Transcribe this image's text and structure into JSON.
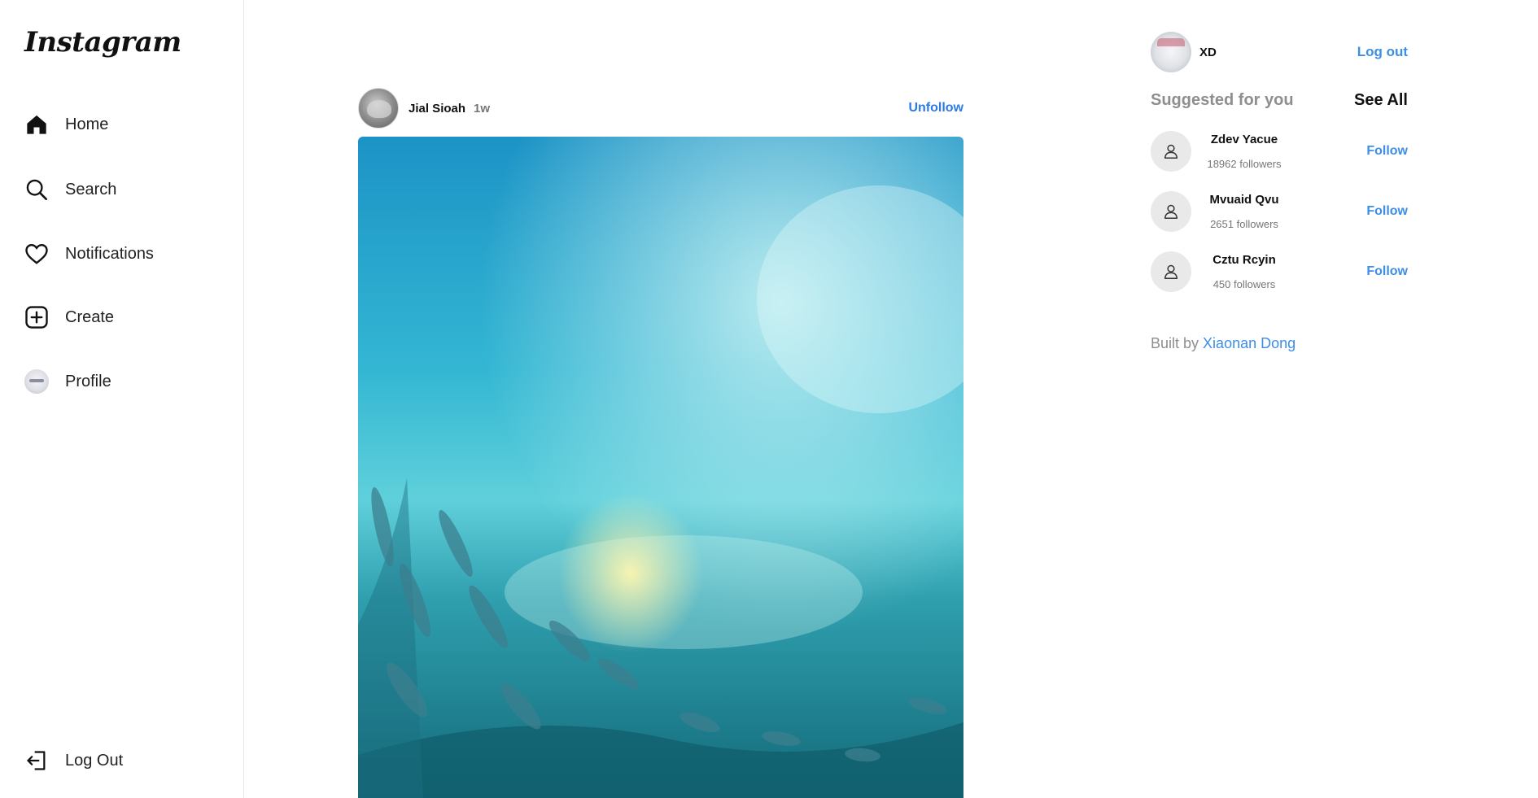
{
  "app": {
    "logo_text": "Instagram"
  },
  "sidebar": {
    "items": [
      {
        "label": "Home",
        "icon": "home-icon"
      },
      {
        "label": "Search",
        "icon": "search-icon"
      },
      {
        "label": "Notifications",
        "icon": "heart-icon"
      },
      {
        "label": "Create",
        "icon": "plus-square-icon"
      },
      {
        "label": "Profile",
        "icon": "avatar"
      }
    ],
    "logout_label": "Log Out",
    "logout_icon": "logout-icon"
  },
  "post": {
    "username": "Jial Sioah",
    "time": "1w",
    "unfollow_label": "Unfollow",
    "image_subject": "underwater-school-of-fish-photo"
  },
  "right": {
    "me": {
      "username": "XD",
      "logout_label": "Log out"
    },
    "suggested_title": "Suggested for you",
    "see_all_label": "See All",
    "suggestions": [
      {
        "name": "Zdev Yacue",
        "followers": "18962 followers",
        "follow_label": "Follow"
      },
      {
        "name": "Mvuaid Qvu",
        "followers": "2651 followers",
        "follow_label": "Follow"
      },
      {
        "name": "Cztu Rcyin",
        "followers": "450 followers",
        "follow_label": "Follow"
      }
    ],
    "footer": {
      "built_by_text": "Built by",
      "author": "Xiaonan Dong"
    }
  },
  "colors": {
    "link_blue": "#3d8ee6",
    "muted_gray": "#8e8e8e",
    "water_top": "#1a8fc2",
    "water_mid": "#35b3cf"
  }
}
